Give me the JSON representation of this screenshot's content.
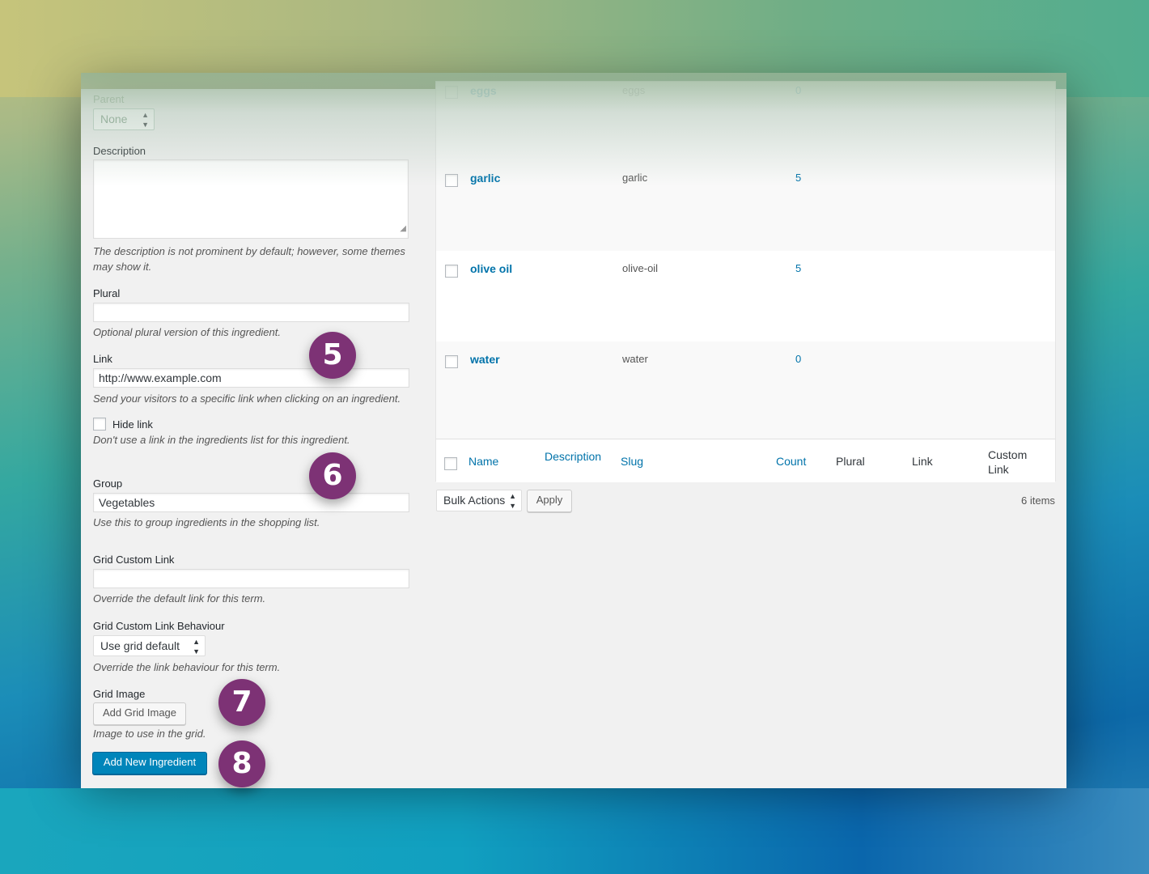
{
  "form": {
    "parent_label": "Parent",
    "parent_value": "None",
    "description_label": "Description",
    "description_hint_line1": "The description is not prominent by default; however, some themes",
    "description_hint_line2": "may show it.",
    "plural_label": "Plural",
    "plural_hint": "Optional plural version of this ingredient.",
    "link_label": "Link",
    "link_value": "http://www.example.com",
    "link_hint": "Send your visitors to a specific link when clicking on an ingredient.",
    "hide_link_label": "Hide link",
    "hide_link_hint": "Don't use a link in the ingredients list for this ingredient.",
    "group_label": "Group",
    "group_value": "Vegetables",
    "group_hint": "Use this to group ingredients in the shopping list.",
    "grid_custom_link_label": "Grid Custom Link",
    "grid_custom_link_hint": "Override the default link for this term.",
    "grid_behaviour_label": "Grid Custom Link Behaviour",
    "grid_behaviour_value": "Use grid default",
    "grid_behaviour_hint": "Override the link behaviour for this term.",
    "grid_image_label": "Grid Image",
    "add_grid_image_button": "Add Grid Image",
    "grid_image_hint": "Image to use in the grid.",
    "submit_button": "Add New Ingredient"
  },
  "badges": [
    "5",
    "6",
    "7",
    "8"
  ],
  "table": {
    "faded_row": {
      "name": "eggs",
      "slug": "eggs",
      "count": "0"
    },
    "rows": [
      {
        "name": "garlic",
        "slug": "garlic",
        "count": "5"
      },
      {
        "name": "olive oil",
        "slug": "olive-oil",
        "count": "5"
      },
      {
        "name": "water",
        "slug": "water",
        "count": "0"
      }
    ],
    "columns": {
      "name": "Name",
      "description": "Description",
      "slug": "Slug",
      "count": "Count",
      "plural": "Plural",
      "link": "Link",
      "custom_link_line1": "Custom",
      "custom_link_line2": "Link"
    }
  },
  "bulk": {
    "select_value": "Bulk Actions",
    "apply_button": "Apply",
    "items_count": "6 items"
  },
  "colors": {
    "primary": "#0085ba",
    "link": "#0073aa",
    "badge": "#7d3275"
  }
}
